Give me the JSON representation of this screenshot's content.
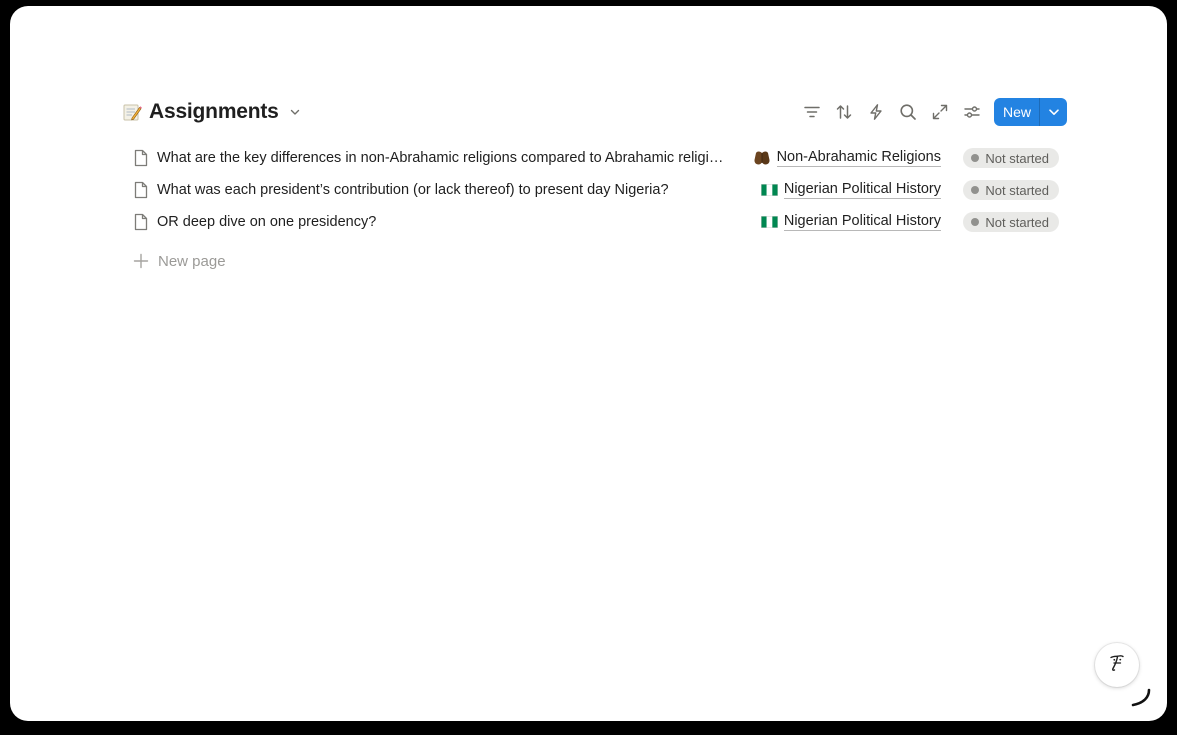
{
  "database": {
    "emoji_icon": "memo-icon",
    "title": "Assignments"
  },
  "toolbar": {
    "icons": [
      "filter-icon",
      "sort-icon",
      "automation-icon",
      "search-icon",
      "expand-icon",
      "settings-icon"
    ],
    "new_label": "New"
  },
  "rows": [
    {
      "title": "What are the key differences in non-Abrahamic religions compared to Abrahamic religions?",
      "relation_icon": "folded-hands-icon",
      "relation": "Non-Abrahamic Religions",
      "status": "Not started"
    },
    {
      "title": "What was each president’s contribution (or lack thereof) to present day Nigeria?",
      "relation_icon": "nigeria-flag-icon",
      "relation": "Nigerian Political History",
      "status": "Not started"
    },
    {
      "title": "OR deep dive on one presidency?",
      "relation_icon": "nigeria-flag-icon",
      "relation": "Nigerian Political History",
      "status": "Not started"
    }
  ],
  "new_page_label": "New page",
  "colors": {
    "accent": "#2383e2",
    "status_bg": "#e9e9e7",
    "status_dot": "#91918e",
    "nigeria_green": "#008751"
  }
}
